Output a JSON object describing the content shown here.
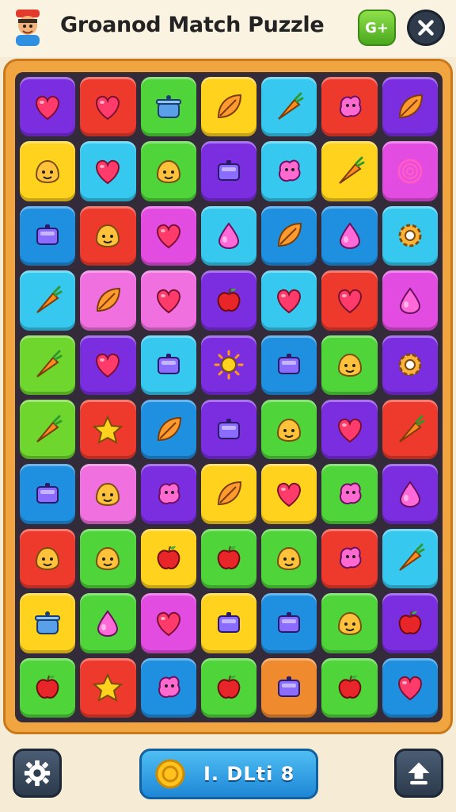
{
  "header": {
    "title": "Groanod Match Puzzle",
    "green_button_label": "G+",
    "avatar_icon": "chef-avatar-icon",
    "close_icon": "close-icon"
  },
  "board": {
    "rows": 10,
    "cols": 7,
    "tiles": [
      [
        {
          "color": "#7b2de0",
          "icon": "heart"
        },
        {
          "color": "#ee3a2d",
          "icon": "heart"
        },
        {
          "color": "#4fd43a",
          "icon": "pot"
        },
        {
          "color": "#ffd21e",
          "icon": "leaf"
        },
        {
          "color": "#37c8f0",
          "icon": "carrot"
        },
        {
          "color": "#ee3a2d",
          "icon": "blob"
        },
        {
          "color": "#7b2de0",
          "icon": "leaf"
        }
      ],
      [
        {
          "color": "#ffd21e",
          "icon": "face"
        },
        {
          "color": "#37c8f0",
          "icon": "heart"
        },
        {
          "color": "#4fd43a",
          "icon": "face"
        },
        {
          "color": "#7b2de0",
          "icon": "box"
        },
        {
          "color": "#37c8f0",
          "icon": "blob"
        },
        {
          "color": "#ffd21e",
          "icon": "carrot"
        },
        {
          "color": "#e34ce0",
          "icon": "spiral"
        }
      ],
      [
        {
          "color": "#1f8fe0",
          "icon": "box"
        },
        {
          "color": "#ee3a2d",
          "icon": "face"
        },
        {
          "color": "#e34ce0",
          "icon": "heart"
        },
        {
          "color": "#37c8f0",
          "icon": "drop"
        },
        {
          "color": "#1f8fe0",
          "icon": "leaf"
        },
        {
          "color": "#1f8fe0",
          "icon": "drop"
        },
        {
          "color": "#37c8f0",
          "icon": "gear"
        }
      ],
      [
        {
          "color": "#37c8f0",
          "icon": "carrot"
        },
        {
          "color": "#f070e0",
          "icon": "leaf"
        },
        {
          "color": "#f070e0",
          "icon": "heart"
        },
        {
          "color": "#7b2de0",
          "icon": "apple"
        },
        {
          "color": "#37c8f0",
          "icon": "heart"
        },
        {
          "color": "#ee3a2d",
          "icon": "heart"
        },
        {
          "color": "#e34ce0",
          "icon": "drop"
        }
      ],
      [
        {
          "color": "#6fd62e",
          "icon": "carrot"
        },
        {
          "color": "#7b2de0",
          "icon": "heart"
        },
        {
          "color": "#37c8f0",
          "icon": "box"
        },
        {
          "color": "#7b2de0",
          "icon": "sun"
        },
        {
          "color": "#1f8fe0",
          "icon": "box"
        },
        {
          "color": "#4fd43a",
          "icon": "face"
        },
        {
          "color": "#7b2de0",
          "icon": "gear"
        }
      ],
      [
        {
          "color": "#6fd62e",
          "icon": "carrot"
        },
        {
          "color": "#ee3a2d",
          "icon": "star"
        },
        {
          "color": "#1f8fe0",
          "icon": "leaf"
        },
        {
          "color": "#7b2de0",
          "icon": "box"
        },
        {
          "color": "#4fd43a",
          "icon": "face"
        },
        {
          "color": "#7b2de0",
          "icon": "heart"
        },
        {
          "color": "#ee3a2d",
          "icon": "carrot"
        }
      ],
      [
        {
          "color": "#1f8fe0",
          "icon": "box"
        },
        {
          "color": "#f070e0",
          "icon": "face"
        },
        {
          "color": "#7b2de0",
          "icon": "blob"
        },
        {
          "color": "#ffd21e",
          "icon": "leaf"
        },
        {
          "color": "#ffd21e",
          "icon": "heart"
        },
        {
          "color": "#4fd43a",
          "icon": "blob"
        },
        {
          "color": "#7b2de0",
          "icon": "drop"
        }
      ],
      [
        {
          "color": "#ee3a2d",
          "icon": "face"
        },
        {
          "color": "#4fd43a",
          "icon": "face"
        },
        {
          "color": "#ffd21e",
          "icon": "apple"
        },
        {
          "color": "#4fd43a",
          "icon": "apple"
        },
        {
          "color": "#4fd43a",
          "icon": "face"
        },
        {
          "color": "#ee3a2d",
          "icon": "blob"
        },
        {
          "color": "#37c8f0",
          "icon": "carrot"
        }
      ],
      [
        {
          "color": "#ffd21e",
          "icon": "pot"
        },
        {
          "color": "#4fd43a",
          "icon": "drop"
        },
        {
          "color": "#e34ce0",
          "icon": "heart"
        },
        {
          "color": "#ffd21e",
          "icon": "box"
        },
        {
          "color": "#1f8fe0",
          "icon": "box"
        },
        {
          "color": "#4fd43a",
          "icon": "face"
        },
        {
          "color": "#7b2de0",
          "icon": "apple"
        }
      ],
      [
        {
          "color": "#4fd43a",
          "icon": "apple"
        },
        {
          "color": "#ee3a2d",
          "icon": "star"
        },
        {
          "color": "#1f8fe0",
          "icon": "blob"
        },
        {
          "color": "#4fd43a",
          "icon": "apple"
        },
        {
          "color": "#f08a2e",
          "icon": "box"
        },
        {
          "color": "#4fd43a",
          "icon": "apple"
        },
        {
          "color": "#1f8fe0",
          "icon": "heart"
        }
      ]
    ]
  },
  "footer": {
    "main_button_label": "I. DLti 8",
    "left_icon": "settings-gear-icon",
    "right_icon": "upload-arrow-icon",
    "coin_icon": "coin-icon"
  }
}
